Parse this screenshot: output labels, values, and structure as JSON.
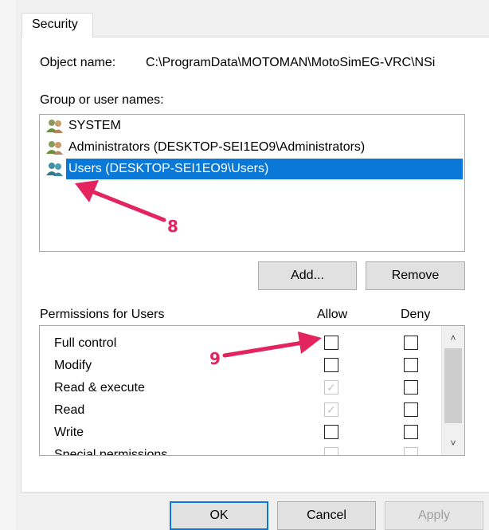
{
  "tab": {
    "label": "Security"
  },
  "object_name": {
    "label": "Object name:",
    "value": "C:\\ProgramData\\MOTOMAN\\MotoSimEG-VRC\\NSi"
  },
  "group_users": {
    "label": "Group or user names:",
    "items": [
      {
        "label": "SYSTEM",
        "icon": "users-group-icon"
      },
      {
        "label": "Administrators (DESKTOP-SEI1EO9\\Administrators)",
        "icon": "users-group-icon"
      },
      {
        "label": "Users (DESKTOP-SEI1EO9\\Users)",
        "icon": "users-group-icon",
        "selected": true
      }
    ]
  },
  "buttons": {
    "add": "Add...",
    "remove": "Remove",
    "ok": "OK",
    "cancel": "Cancel",
    "apply": "Apply"
  },
  "permissions": {
    "label": "Permissions for Users",
    "allow_header": "Allow",
    "deny_header": "Deny",
    "rows": [
      {
        "name": "Full control",
        "allow": false,
        "allow_disabled": false,
        "deny": false
      },
      {
        "name": "Modify",
        "allow": false,
        "allow_disabled": false,
        "deny": false
      },
      {
        "name": "Read & execute",
        "allow": true,
        "allow_disabled": true,
        "deny": false
      },
      {
        "name": "Read",
        "allow": true,
        "allow_disabled": true,
        "deny": false
      },
      {
        "name": "Write",
        "allow": false,
        "allow_disabled": false,
        "deny": false
      },
      {
        "name": "Special permissions",
        "allow": false,
        "allow_disabled": true,
        "deny": false
      }
    ]
  },
  "annotations": {
    "step8": "8",
    "step9": "9",
    "arrow_color": "#e3245f"
  },
  "colors": {
    "selection": "#0a78d7",
    "annotation": "#e3245f"
  }
}
